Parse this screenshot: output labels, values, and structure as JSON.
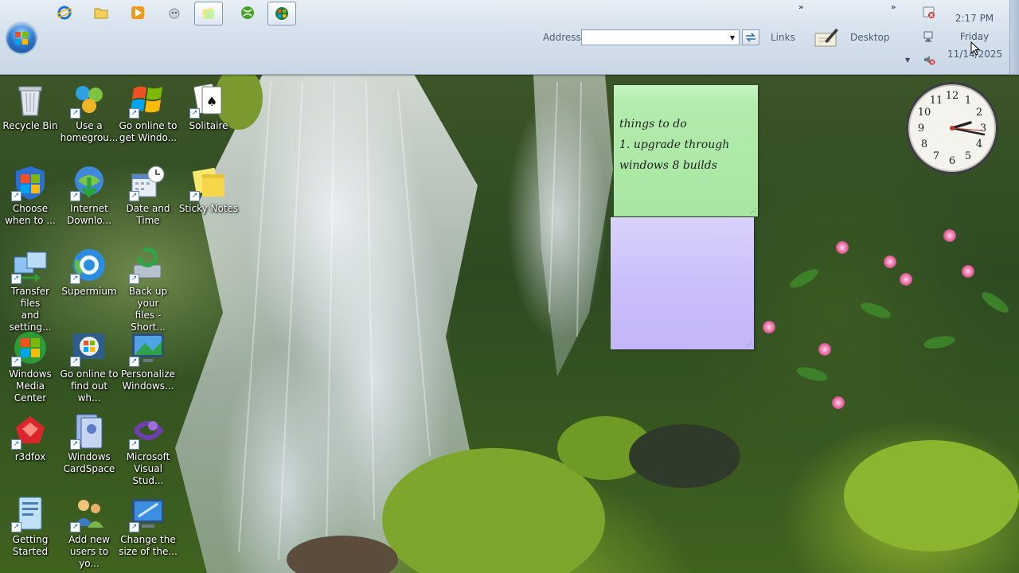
{
  "taskbar": {
    "quick_launch": [
      {
        "name": "ie-icon",
        "active": false
      },
      {
        "name": "folder-icon",
        "active": false
      },
      {
        "name": "media-player-icon",
        "active": false
      },
      {
        "name": "game-icon",
        "active": false
      },
      {
        "name": "sticky-notes-taskbar-icon",
        "active": true
      },
      {
        "name": "xbox-icon",
        "active": false
      },
      {
        "name": "windows-media-center-taskbar-icon",
        "active": true
      }
    ],
    "address_label": "Address",
    "address_value": "",
    "links_label": "Links",
    "desktop_label": "Desktop",
    "chevron": "»"
  },
  "clock": {
    "time": "2:17 PM",
    "day": "Friday",
    "date": "11/14/2025"
  },
  "desktop_icons": [
    {
      "label": "Recycle Bin",
      "icon": "recycle-bin-icon",
      "shortcut": false
    },
    {
      "label": "Choose\nwhen to ...",
      "icon": "windows-shield-icon",
      "shortcut": true
    },
    {
      "label": "Transfer files\nand setting...",
      "icon": "transfer-files-icon",
      "shortcut": true
    },
    {
      "label": "Windows\nMedia Center",
      "icon": "windows-media-center-icon",
      "shortcut": true
    },
    {
      "label": "r3dfox",
      "icon": "r3dfox-icon",
      "shortcut": true
    },
    {
      "label": "Getting\nStarted",
      "icon": "getting-started-icon",
      "shortcut": true
    },
    {
      "label": "Use a\nhomegrou...",
      "icon": "homegroup-icon",
      "shortcut": true
    },
    {
      "label": "Internet\nDownlo...",
      "icon": "internet-download-icon",
      "shortcut": true
    },
    {
      "label": "Supermium",
      "icon": "supermium-icon",
      "shortcut": true
    },
    {
      "label": "Go online to\nfind out wh...",
      "icon": "windows-online-icon",
      "shortcut": true
    },
    {
      "label": "Windows\nCardSpace",
      "icon": "cardspace-icon",
      "shortcut": true
    },
    {
      "label": "Add new\nusers to yo...",
      "icon": "users-icon",
      "shortcut": true
    },
    {
      "label": "Go online to\nget Windo...",
      "icon": "windows-logo-icon",
      "shortcut": true
    },
    {
      "label": "Date and\nTime",
      "icon": "date-time-icon",
      "shortcut": true
    },
    {
      "label": "Back up your\nfiles - Short...",
      "icon": "backup-icon",
      "shortcut": true
    },
    {
      "label": "Personalize\nWindows...",
      "icon": "personalize-icon",
      "shortcut": true
    },
    {
      "label": "Microsoft\nVisual Stud...",
      "icon": "visual-studio-icon",
      "shortcut": true
    },
    {
      "label": "Change the\nsize of the...",
      "icon": "monitor-icon",
      "shortcut": true
    },
    {
      "label": "Solitaire",
      "icon": "solitaire-icon",
      "shortcut": true
    },
    {
      "label": "Sticky Notes",
      "icon": "sticky-notes-icon",
      "shortcut": true
    }
  ],
  "sticky_notes": [
    {
      "color": "#b2ecac",
      "text": "things to do\n1. upgrade through\nwindows 8 builds"
    },
    {
      "color": "#cbbffa",
      "text": ""
    }
  ],
  "colors": {
    "taskbar": "#d6e1ec",
    "note_green": "#b2ecac",
    "note_purple": "#cbbffa"
  }
}
